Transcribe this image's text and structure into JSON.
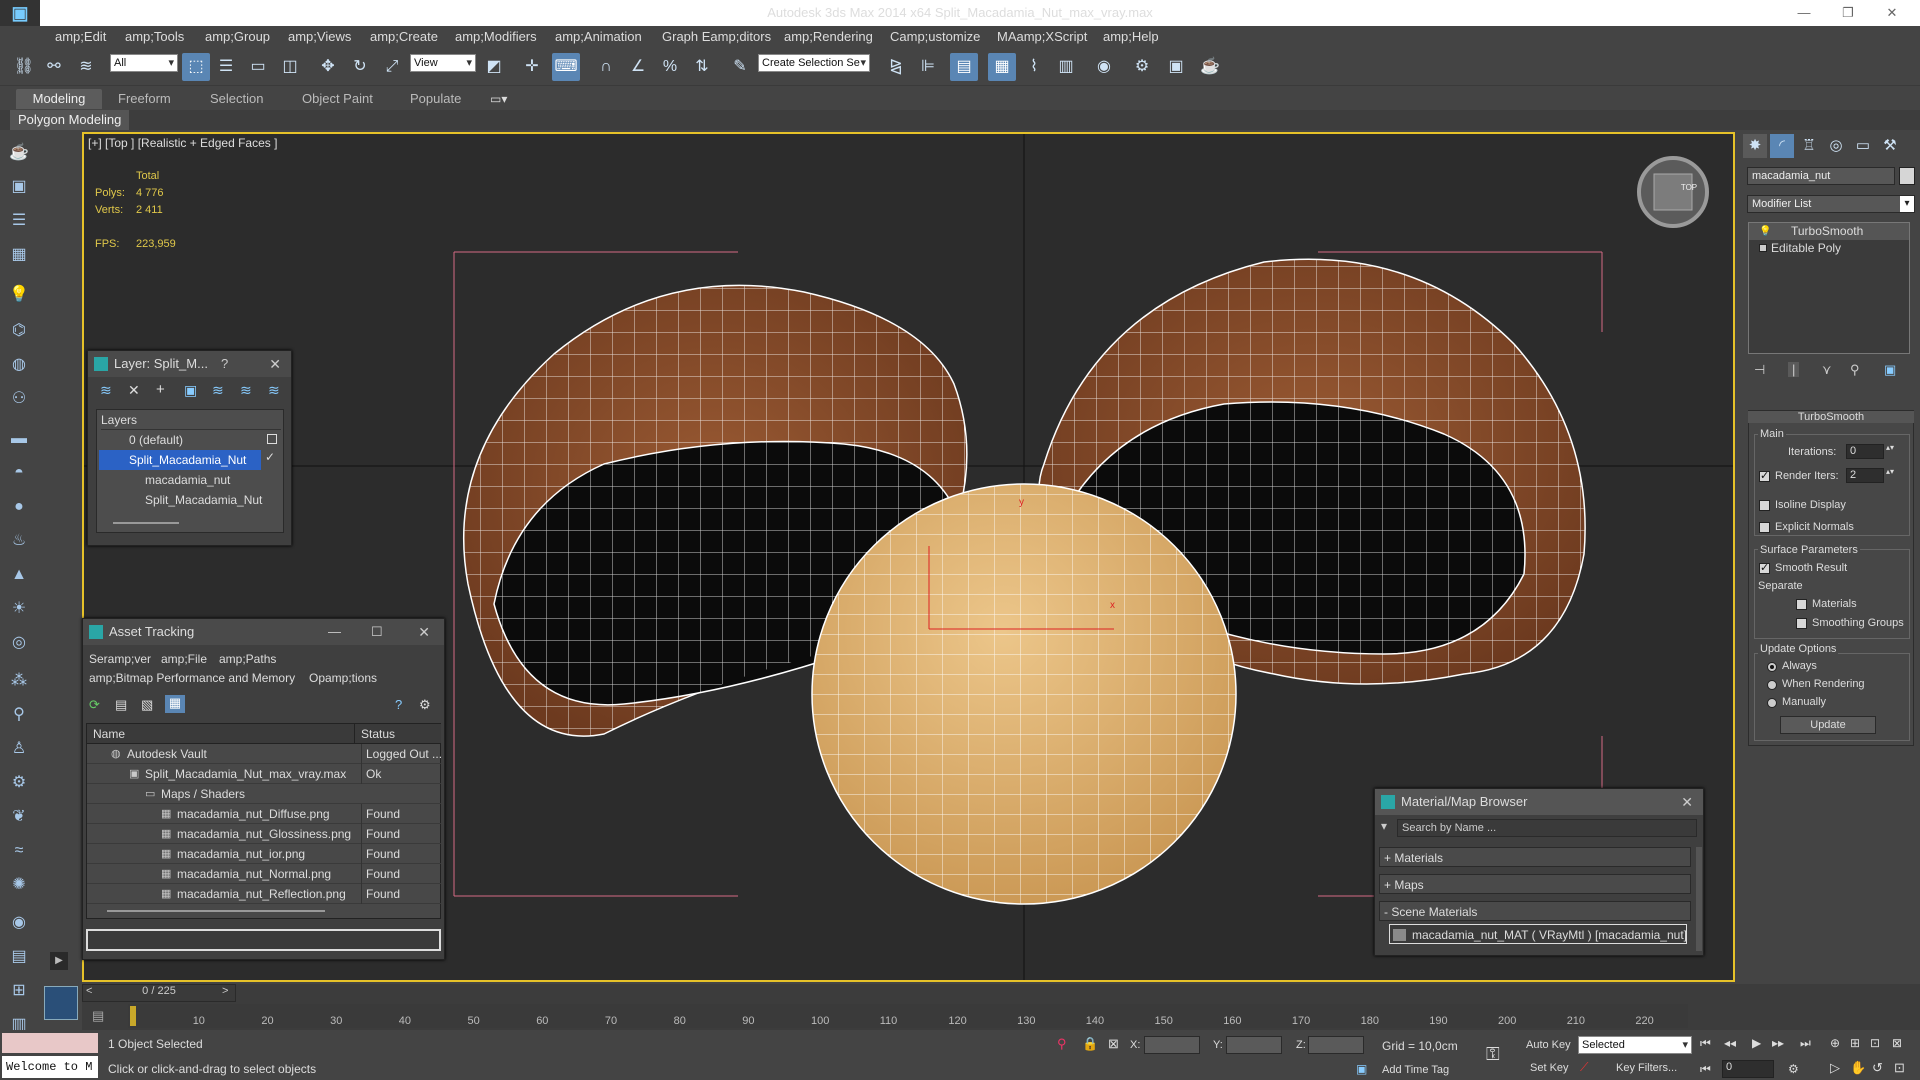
{
  "app": {
    "title": "Autodesk 3ds Max  2014 x64     Split_Macadamia_Nut_max_vray.max",
    "window_controls": [
      "—",
      "❐",
      "✕"
    ]
  },
  "menu": [
    "amp;Edit",
    "amp;Tools",
    "amp;Group",
    "amp;Views",
    "amp;Create",
    "amp;Modifiers",
    "amp;Animation",
    "Graph Eamp;ditors",
    "amp;Rendering",
    "Camp;ustomize",
    "MAamp;XScript",
    "amp;Help"
  ],
  "toolbar": {
    "filter_select": "All",
    "refcoord_select": "View",
    "named_selection": "Create Selection Se"
  },
  "ribbon": {
    "tabs": [
      "Modeling",
      "Freeform",
      "Selection",
      "Object Paint",
      "Populate"
    ],
    "active_tab": "Modeling",
    "sub_label": "Polygon Modeling"
  },
  "viewport": {
    "label": "[+] [Top ] [Realistic + Edged Faces ]",
    "stats_header": "Total",
    "polys_label": "Polys:",
    "polys_value": "4 776",
    "verts_label": "Verts:",
    "verts_value": "2 411",
    "fps_label": "FPS:",
    "fps_value": "223,959",
    "viewcube_label": "TOP",
    "axis_y": "y",
    "axis_x": "x"
  },
  "layer_panel": {
    "title": "Layer: Split_M...",
    "help": "?",
    "header": "Layers",
    "items": [
      "0 (default)",
      "Split_Macadamia_Nut",
      "macadamia_nut",
      "Split_Macadamia_Nut"
    ]
  },
  "asset_tracking": {
    "title": "Asset Tracking",
    "menu": [
      "Seramp;ver",
      "amp;File",
      "amp;Paths",
      "amp;Bitmap Performance and Memory",
      "Opamp;tions"
    ],
    "columns": [
      "Name",
      "Status"
    ],
    "rows": [
      {
        "name": "Autodesk Vault",
        "status": "Logged Out ..."
      },
      {
        "name": "Split_Macadamia_Nut_max_vray.max",
        "status": "Ok"
      },
      {
        "name": "Maps / Shaders",
        "status": ""
      },
      {
        "name": "macadamia_nut_Diffuse.png",
        "status": "Found"
      },
      {
        "name": "macadamia_nut_Glossiness.png",
        "status": "Found"
      },
      {
        "name": "macadamia_nut_ior.png",
        "status": "Found"
      },
      {
        "name": "macadamia_nut_Normal.png",
        "status": "Found"
      },
      {
        "name": "macadamia_nut_Reflection.png",
        "status": "Found"
      }
    ]
  },
  "material_browser": {
    "title": "Material/Map Browser",
    "search_placeholder": "Search by Name ...",
    "sections": [
      "+ Materials",
      "+ Maps",
      "- Scene Materials"
    ],
    "scene_item": "macadamia_nut_MAT  ( VRayMtl )  [macadamia_nut]"
  },
  "command_panel": {
    "object_name": "macadamia_nut",
    "modifier_list": "Modifier List",
    "stack": [
      "TurboSmooth",
      "Editable Poly"
    ],
    "rollout_title": "TurboSmooth",
    "main_group": "Main",
    "iterations_label": "Iterations:",
    "iterations_value": "0",
    "render_iters_label": "Render Iters:",
    "render_iters_value": "2",
    "render_iters_checked": true,
    "isoline_label": "Isoline Display",
    "explicit_label": "Explicit Normals",
    "surface_group": "Surface Parameters",
    "smooth_result_label": "Smooth Result",
    "separate_label": "Separate",
    "materials_label": "Materials",
    "smoothing_groups_label": "Smoothing Groups",
    "update_group": "Update Options",
    "update_options": [
      "Always",
      "When Rendering",
      "Manually"
    ],
    "update_selected": "Always",
    "update_button": "Update"
  },
  "timeline": {
    "frame_display": "0 / 225",
    "ticks": [
      "10",
      "20",
      "30",
      "40",
      "50",
      "60",
      "70",
      "80",
      "90",
      "100",
      "110",
      "120",
      "130",
      "140",
      "150",
      "160",
      "170",
      "180",
      "190",
      "200",
      "210",
      "220"
    ]
  },
  "statusbar": {
    "maxscript_text": "Welcome to M",
    "selection_info": "1 Object Selected",
    "prompt": "Click or click-and-drag to select objects",
    "x_label": "X:",
    "y_label": "Y:",
    "z_label": "Z:",
    "grid": "Grid = 10,0cm",
    "add_time_tag": "Add Time Tag",
    "auto_key": "Auto Key",
    "auto_key_mode": "Selected",
    "set_key": "Set Key",
    "key_filters": "Key Filters...",
    "current_frame": "0"
  }
}
